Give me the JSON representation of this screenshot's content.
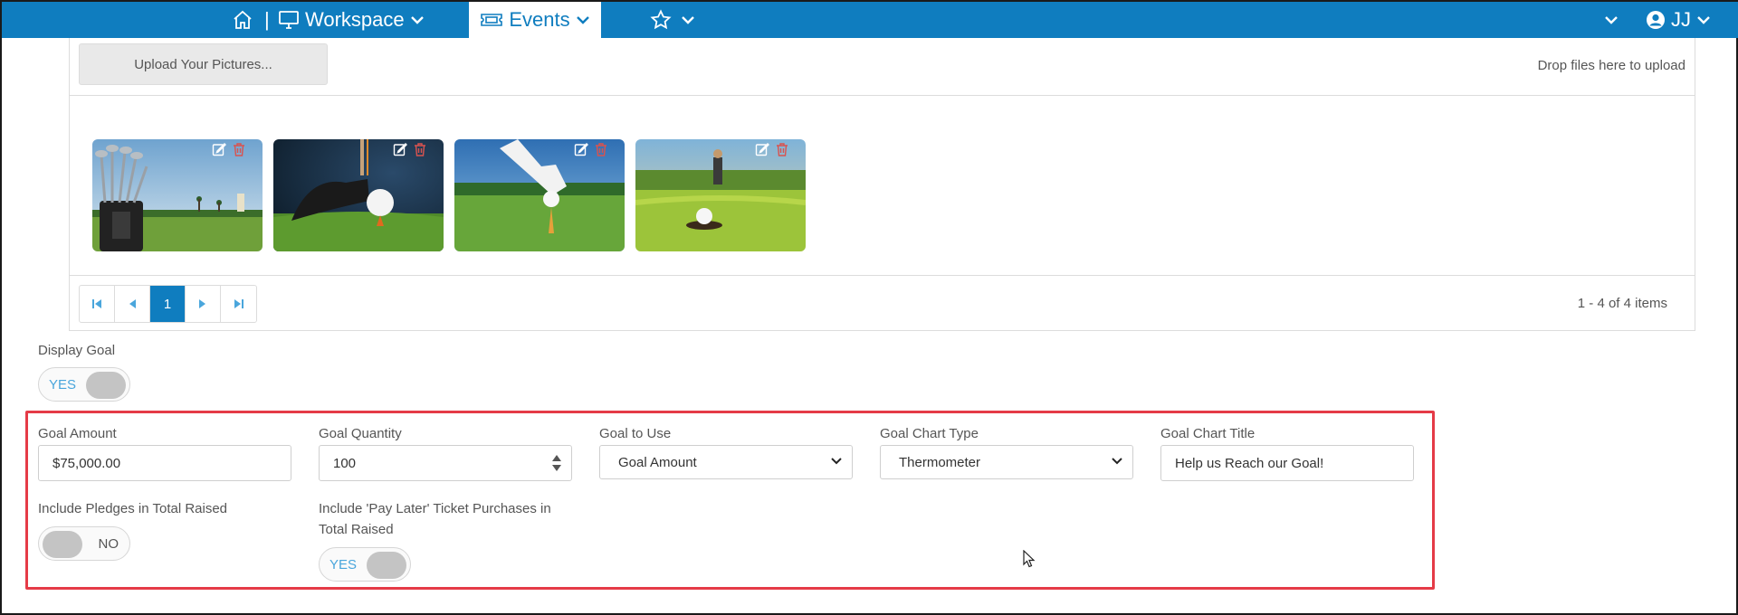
{
  "nav": {
    "separator": "|",
    "workspace_label": "Workspace",
    "events_label": "Events",
    "user_initials": "JJ"
  },
  "upload": {
    "button_label": "Upload Your Pictures...",
    "drop_text": "Drop files here to upload"
  },
  "gallery": {
    "images": [
      {
        "name": "golf-bag-photo"
      },
      {
        "name": "golf-club-ball-photo"
      },
      {
        "name": "gloved-hand-tee-photo"
      },
      {
        "name": "golfer-putting-photo"
      }
    ]
  },
  "pager": {
    "current_page": "1",
    "info": "1 - 4 of 4 items"
  },
  "display_goal": {
    "label": "Display Goal",
    "toggle_text": "YES"
  },
  "goal_form": {
    "goal_amount": {
      "label": "Goal Amount",
      "value": "$75,000.00"
    },
    "goal_quantity": {
      "label": "Goal Quantity",
      "value": "100"
    },
    "goal_to_use": {
      "label": "Goal to Use",
      "value": "Goal Amount"
    },
    "goal_chart_type": {
      "label": "Goal Chart Type",
      "value": "Thermometer"
    },
    "goal_chart_title": {
      "label": "Goal Chart Title",
      "value": "Help us Reach our Goal!"
    },
    "include_pledges": {
      "label": "Include Pledges in Total Raised",
      "toggle_text": "NO"
    },
    "include_pay_later": {
      "label_line1": "Include 'Pay Later' Ticket Purchases in",
      "label_line2": "Total Raised",
      "toggle_text": "YES"
    }
  },
  "colors": {
    "nav_bg": "#0f7dbf",
    "accent": "#4aa6dc",
    "highlight": "#e53b47"
  }
}
